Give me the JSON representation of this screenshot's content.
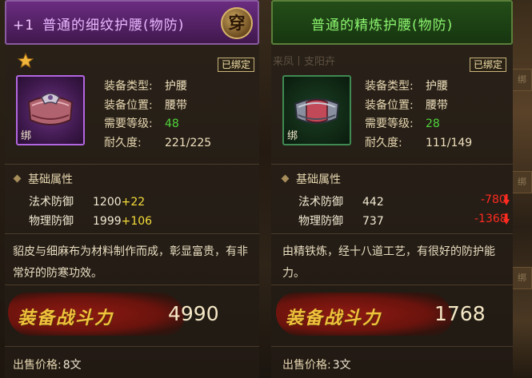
{
  "left_item": {
    "header": {
      "plus": "+1",
      "name": "普通的细纹护腰(物防)",
      "badge": "穿"
    },
    "star_icon": "star-icon",
    "bound_label": "已绑定",
    "icon": {
      "name": "waist-belt-purple-icon",
      "bind_tag": "绑"
    },
    "attributes": [
      {
        "key": "装备类型:",
        "value": "护腰"
      },
      {
        "key": "装备位置:",
        "value": "腰带"
      },
      {
        "key": "需要等级:",
        "value": "48"
      },
      {
        "key": "耐久度:",
        "value": "221/225"
      }
    ],
    "base_title": "基础属性",
    "base_stats": [
      {
        "key": "法术防御",
        "value": "1200",
        "bonus": "+22"
      },
      {
        "key": "物理防御",
        "value": "1999",
        "bonus": "+106"
      }
    ],
    "description": "貂皮与细麻布为材料制作而成，彰显富贵，有非常好的防寒功效。",
    "power_label": "装备战斗力",
    "power_value": "4990",
    "price_label": "出售价格:",
    "price_value": "8文"
  },
  "right_item": {
    "header": {
      "name": "普通的精炼护腰(物防)"
    },
    "bound_label": "已绑定",
    "ghost_text": "来凤丨支阳卉",
    "icon": {
      "name": "waist-belt-green-icon",
      "bind_tag": "绑"
    },
    "attributes": [
      {
        "key": "装备类型:",
        "value": "护腰"
      },
      {
        "key": "装备位置:",
        "value": "腰带"
      },
      {
        "key": "需要等级:",
        "value": "28"
      },
      {
        "key": "耐久度:",
        "value": "111/149"
      }
    ],
    "base_title": "基础属性",
    "base_stats": [
      {
        "key": "法术防御",
        "value": "442",
        "diff": "-780"
      },
      {
        "key": "物理防御",
        "value": "737",
        "diff": "-1368"
      }
    ],
    "description": "由精铁炼，经十八道工艺，有很好的防护能力。",
    "power_label": "装备战斗力",
    "power_value": "1768",
    "price_label": "出售价格:",
    "price_value": "3文"
  },
  "side_tabs": [
    "绑",
    "绑",
    "绑"
  ],
  "colors": {
    "left_title": "#e9b8ff",
    "right_title": "#8cf56f",
    "level_green": "#4fd33a",
    "bonus_yellow": "#f7de3a",
    "diff_red": "#ff2a20",
    "power_gold": "#f0c33c"
  }
}
